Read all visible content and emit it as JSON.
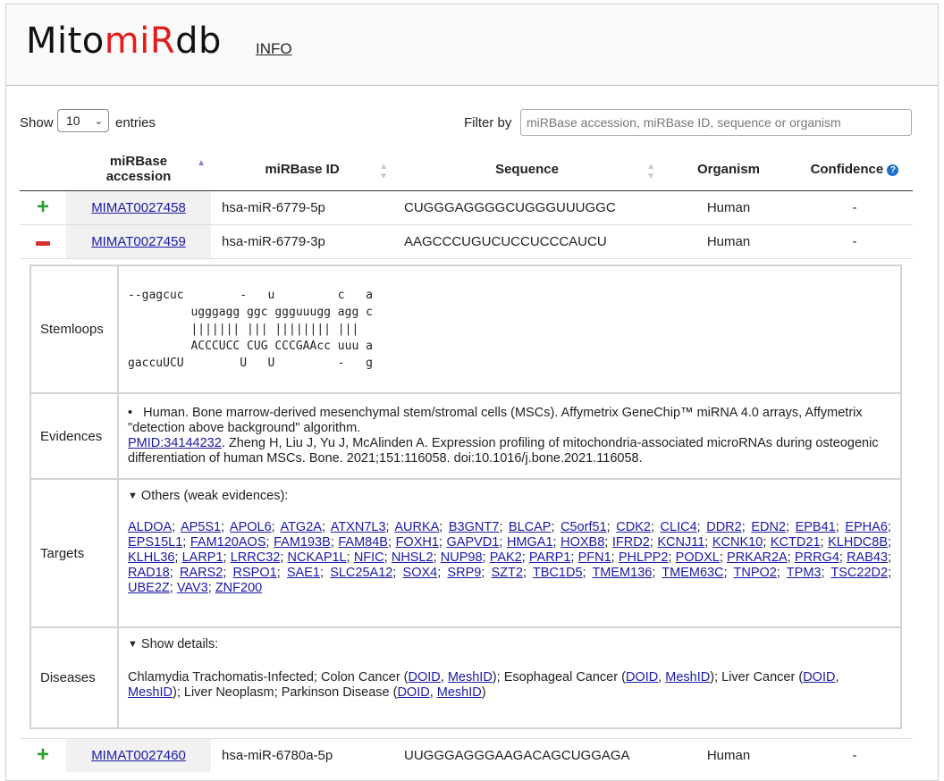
{
  "header": {
    "logo_part1": "Mito",
    "logo_part2": "miR",
    "logo_part3": "db",
    "info_link": "INFO"
  },
  "controls": {
    "show_label": "Show",
    "entries_value": "10",
    "entries_label": "entries",
    "filter_label": "Filter by",
    "filter_placeholder": "miRBase accession, miRBase ID, sequence or organism"
  },
  "columns": {
    "accession": "miRBase accession",
    "id": "miRBase ID",
    "sequence": "Sequence",
    "organism": "Organism",
    "confidence": "Confidence",
    "help_icon": "?"
  },
  "rows": [
    {
      "accession": "MIMAT0027458",
      "id": "hsa-miR-6779-5p",
      "sequence": "CUGGGAGGGGCUGGGUUUGGC",
      "organism": "Human",
      "confidence": "-",
      "expanded": false
    },
    {
      "accession": "MIMAT0027459",
      "id": "hsa-miR-6779-3p",
      "sequence": "AAGCCCUGUCUCCUCCCAUCU",
      "organism": "Human",
      "confidence": "-",
      "expanded": true
    },
    {
      "accession": "MIMAT0027460",
      "id": "hsa-miR-6780a-5p",
      "sequence": "UUGGGAGGGAAGACAGCUGGAGA",
      "organism": "Human",
      "confidence": "-",
      "expanded": false
    }
  ],
  "detail": {
    "stemloops_label": "Stemloops",
    "stemloop": "--gagcuc        -   u         c   a\n         ugggagg ggc ggguuugg agg c\n         ||||||| ||| |||||||| |||\n         ACCCUCC CUG CCCGAAcc uuu a\ngaccuUCU        U   U         -   g",
    "evidences_label": "Evidences",
    "evidence_text": "Human. Bone marrow-derived mesenchymal stem/stromal cells (MSCs). Affymetrix GeneChip™ miRNA 4.0 arrays, Affymetrix \"detection above background\" algorithm.",
    "pmid_link": "PMID:34144232",
    "citation": ". Zheng H, Liu J, Yu J, McAlinden A. Expression profiling of mitochondria-associated microRNAs during osteogenic differentiation of human MSCs. Bone. 2021;151:116058. doi:10.1016/j.bone.2021.116058.",
    "targets_label": "Targets",
    "targets_toggle": "Others (weak evidences):",
    "targets": [
      "ALDOA",
      "AP5S1",
      "APOL6",
      "ATG2A",
      "ATXN7L3",
      "AURKA",
      "B3GNT7",
      "BLCAP",
      "C5orf51",
      "CDK2",
      "CLIC4",
      "DDR2",
      "EDN2",
      "EPB41",
      "EPHA6",
      "EPS15L1",
      "FAM120AOS",
      "FAM193B",
      "FAM84B",
      "FOXH1",
      "GAPVD1",
      "HMGA1",
      "HOXB8",
      "IFRD2",
      "KCNJ11",
      "KCNK10",
      "KCTD21",
      "KLHDC8B",
      "KLHL36",
      "LARP1",
      "LRRC32",
      "NCKAP1L",
      "NFIC",
      "NHSL2",
      "NUP98",
      "PAK2",
      "PARP1",
      "PFN1",
      "PHLPP2",
      "PODXL",
      "PRKAR2A",
      "PRRG4",
      "RAB43",
      "RAD18",
      "RARS2",
      "RSPO1",
      "SAE1",
      "SLC25A12",
      "SOX4",
      "SRP9",
      "SZT2",
      "TBC1D5",
      "TMEM136",
      "TMEM63C",
      "TNPO2",
      "TPM3",
      "TSC22D2",
      "UBE2Z",
      "VAV3",
      "ZNF200"
    ],
    "diseases_label": "Diseases",
    "diseases_toggle": "Show details:",
    "diseases": [
      {
        "name": "Chlamydia Trachomatis-Infected",
        "links": []
      },
      {
        "name": "Colon Cancer",
        "links": [
          "DOID",
          "MeshID"
        ]
      },
      {
        "name": "Esophageal Cancer",
        "links": [
          "DOID",
          "MeshID"
        ]
      },
      {
        "name": "Liver Cancer",
        "links": [
          "DOID",
          "MeshID"
        ]
      },
      {
        "name": "Liver Neoplasm",
        "links": []
      },
      {
        "name": "Parkinson Disease",
        "links": [
          "DOID",
          "MeshID"
        ]
      }
    ]
  }
}
